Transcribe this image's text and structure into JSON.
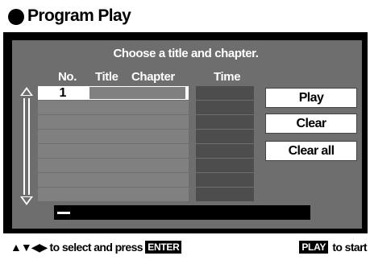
{
  "header": {
    "title": "Program Play"
  },
  "panel": {
    "heading": "Choose a title and chapter.",
    "columns": {
      "no": "No.",
      "title": "Title",
      "chapter": "Chapter",
      "time": "Time"
    },
    "rows": [
      {
        "no": "1",
        "selected": true
      },
      {
        "no": ""
      },
      {
        "no": ""
      },
      {
        "no": ""
      },
      {
        "no": ""
      },
      {
        "no": ""
      },
      {
        "no": ""
      },
      {
        "no": ""
      }
    ]
  },
  "buttons": {
    "play": "Play",
    "clear": "Clear",
    "clear_all": "Clear all"
  },
  "footer": {
    "arrows": "▲▼◀▶",
    "select_text": " to select and press ",
    "enter_key": "ENTER",
    "play_key": "PLAY",
    "start_text": " to start"
  },
  "colors": {
    "panel_bg": "#6e6e6e",
    "row": "#808080",
    "time_cell": "#4d4d4d",
    "frame": "#000000",
    "selected_row": "#ffffff"
  }
}
